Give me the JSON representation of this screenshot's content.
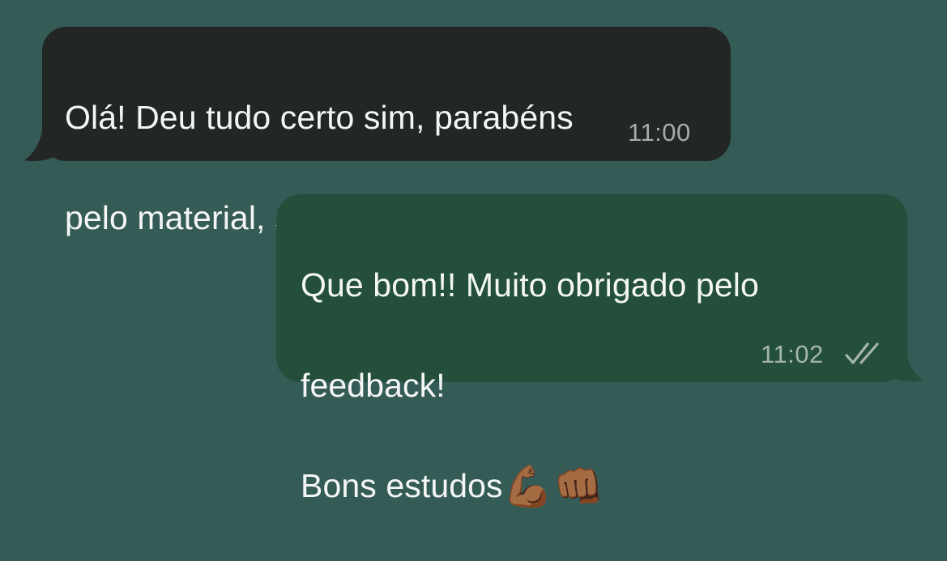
{
  "conversation": {
    "background_color": "#355b57",
    "messages": [
      {
        "direction": "incoming",
        "bubble_color": "#222624",
        "lines": [
          "Olá! Deu tudo certo sim, parabéns",
          "pelo material, show!"
        ],
        "emojis": [
          "👏",
          "👏"
        ],
        "time": "11:00"
      },
      {
        "direction": "outgoing",
        "bubble_color": "#234f3b",
        "lines": [
          "Que bom!! Muito obrigado pelo",
          "feedback!",
          "Bons estudos"
        ],
        "emojis": [
          "💪🏾",
          "👊🏾"
        ],
        "time": "11:02",
        "status_icon": "double-check-icon",
        "status": "read"
      }
    ]
  }
}
